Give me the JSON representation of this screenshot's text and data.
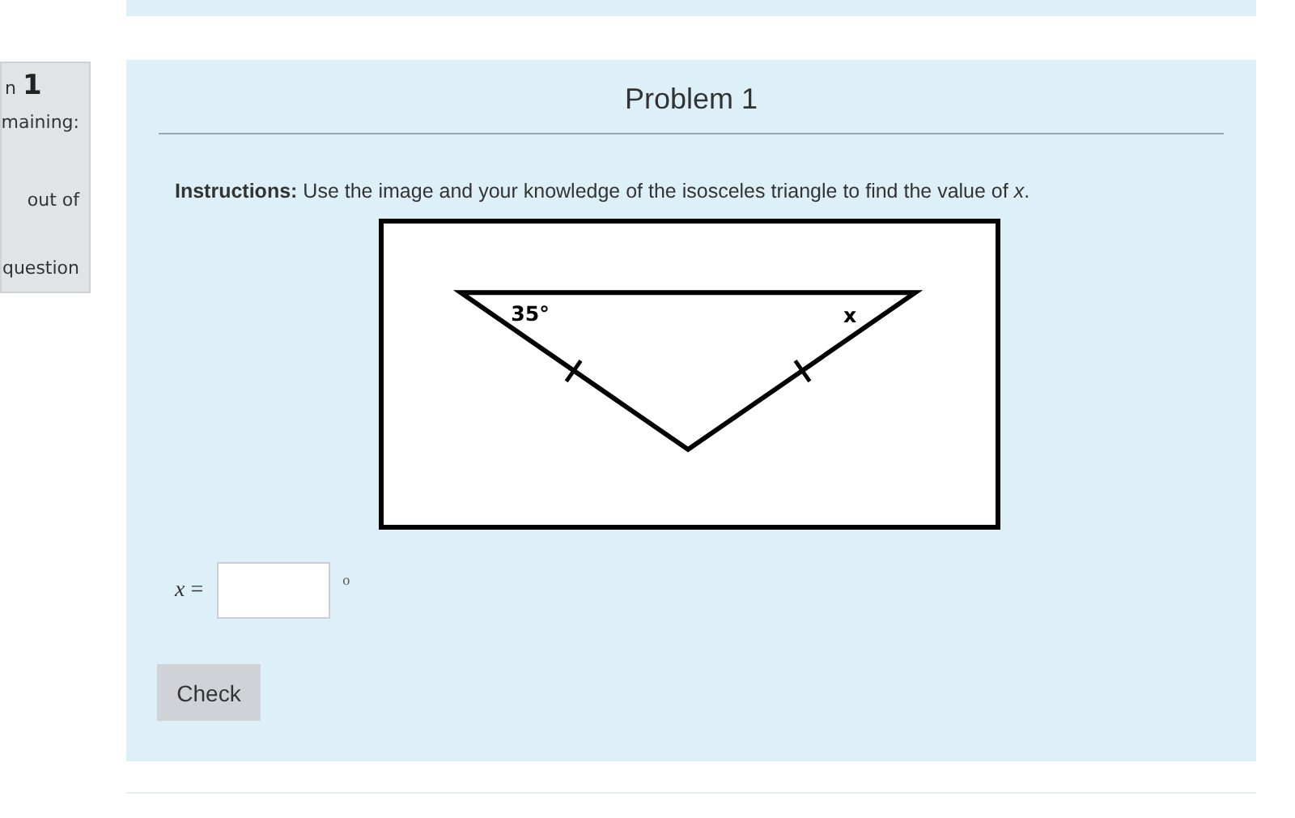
{
  "sidebar": {
    "heading_prefix": "n",
    "heading_number": "1",
    "lines": [
      "maining:",
      "out of",
      "question"
    ]
  },
  "problem": {
    "title": "Problem 1",
    "instructions": "**Instructions:** Use the image and your knowledge of the isosceles triangle to find the value of *x*.",
    "figure": {
      "angle_label": "35°",
      "unknown_label": "x"
    },
    "answer": {
      "label": "*x* =",
      "unit": "o"
    },
    "button": "Check"
  }
}
